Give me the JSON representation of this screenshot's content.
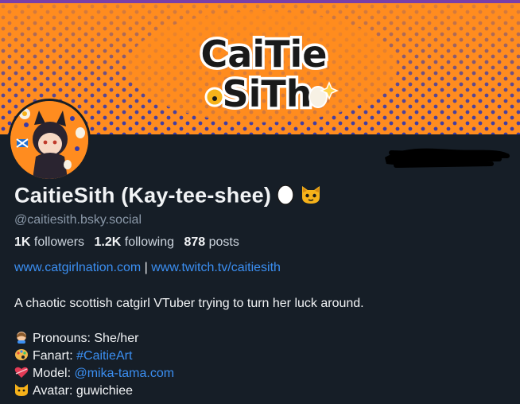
{
  "banner": {
    "logo_line1": "CaiTie",
    "logo_line2": "SiTh",
    "bg_color": "#ff8c1f",
    "dot_color": "#3a3aa8"
  },
  "profile": {
    "display_name": "CaitieSith (Kay-tee-shee)",
    "name_emojis": [
      "egg-icon",
      "cat-face-icon"
    ],
    "handle": "@caitiesith.bsky.social",
    "followers_count": "1K",
    "followers_label": "followers",
    "following_count": "1.2K",
    "following_label": "following",
    "posts_count": "878",
    "posts_label": "posts"
  },
  "links": {
    "link1": "www.catgirlnation.com",
    "separator": "|",
    "link2": "www.twitch.tv/caitiesith"
  },
  "bio": {
    "tagline": "A chaotic scottish catgirl VTuber trying to turn her luck around.",
    "pronouns_label": "Pronouns: She/her",
    "fanart_label": "Fanart:",
    "fanart_tag": "#CaitieArt",
    "model_label": "Model:",
    "model_link": "@mika-tama.com",
    "avatar_label": "Avatar: guwichiee"
  },
  "colors": {
    "background": "#161e27",
    "accent_link": "#3b8ff2",
    "muted_text": "#8a98a8"
  }
}
